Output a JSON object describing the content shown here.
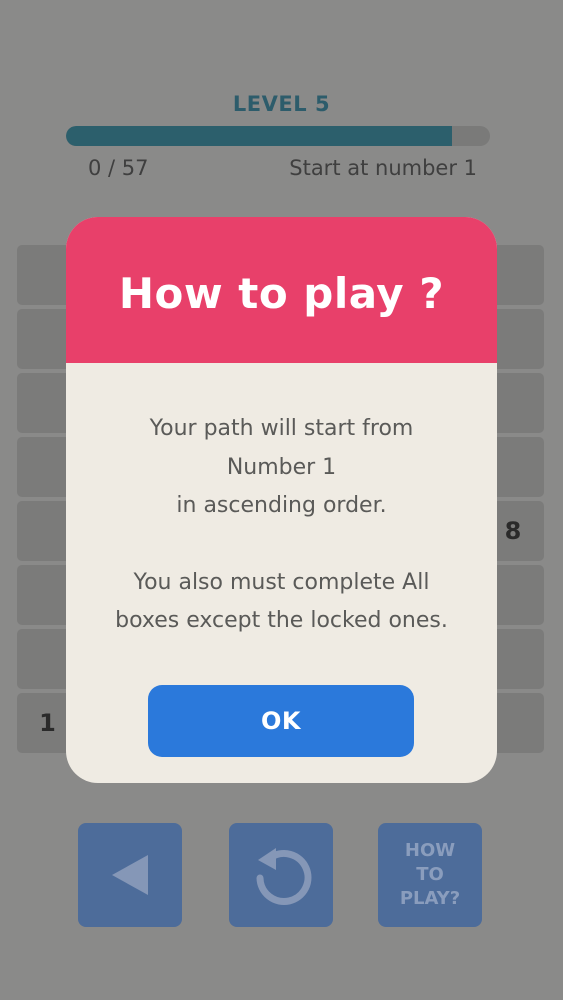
{
  "header": {
    "level_label": "LEVEL 5",
    "progress_count": "0 / 57",
    "progress_fraction": 0.91,
    "hint": "Start at number 1"
  },
  "board": {
    "visible_numbers": [
      {
        "row": 4,
        "col": 7,
        "value": "8"
      },
      {
        "row": 7,
        "col": 0,
        "value": "1"
      }
    ]
  },
  "modal": {
    "title": "How to play ?",
    "line1": "Your path will start from",
    "line2": "Number 1",
    "line3": "in ascending order.",
    "line4": "You also must complete All",
    "line5": "boxes except the locked ones.",
    "ok_label": "OK"
  },
  "controls": {
    "back_icon": "left-triangle-icon",
    "undo_icon": "undo-arrow-icon",
    "howto_line1": "HOW",
    "howto_line2": "TO",
    "howto_line3": "PLAY?"
  },
  "colors": {
    "accent_pink": "#e8406a",
    "ok_blue": "#2b79db",
    "progress_teal": "#2c5f6c",
    "control_blue": "#4d6c9a"
  }
}
